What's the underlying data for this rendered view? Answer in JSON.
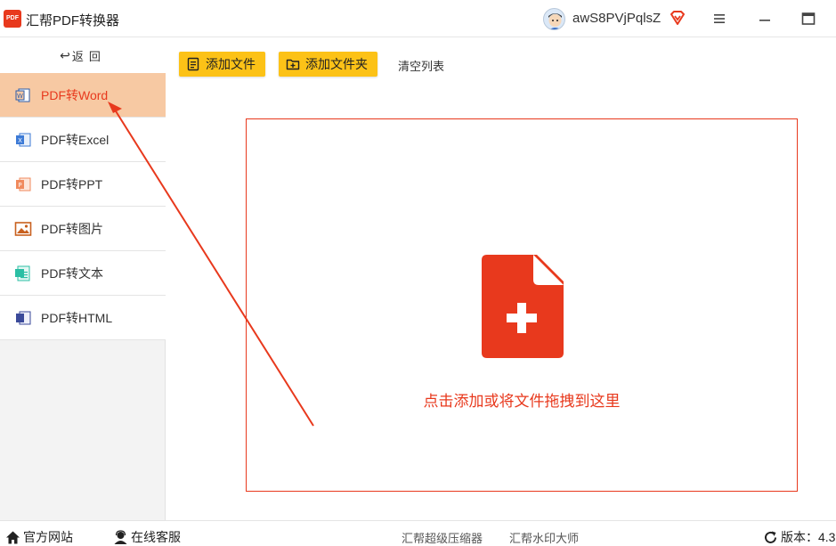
{
  "app": {
    "logo_text": "PDF",
    "title": "汇帮PDF转换器",
    "username": "awS8PVjPqlsZ"
  },
  "sidebar": {
    "back_label": "返回",
    "items": [
      {
        "label": "PDF转Word",
        "icon": "word-icon",
        "active": true
      },
      {
        "label": "PDF转Excel",
        "icon": "excel-icon",
        "active": false
      },
      {
        "label": "PDF转PPT",
        "icon": "ppt-icon",
        "active": false
      },
      {
        "label": "PDF转图片",
        "icon": "image-icon",
        "active": false
      },
      {
        "label": "PDF转文本",
        "icon": "text-icon",
        "active": false
      },
      {
        "label": "PDF转HTML",
        "icon": "html-icon",
        "active": false
      }
    ]
  },
  "toolbar": {
    "add_file": "添加文件",
    "add_folder": "添加文件夹",
    "clear_list": "清空列表"
  },
  "dropzone": {
    "hint": "点击添加或将文件拖拽到这里"
  },
  "statusbar": {
    "website": "官方网站",
    "support": "在线客服",
    "link1": "汇帮超级压缩器",
    "link2": "汇帮水印大师",
    "version": "版本：4.3"
  },
  "colors": {
    "accent": "#e8391d",
    "button_yellow": "#fcc217",
    "active_bg": "#f7c9a3"
  }
}
